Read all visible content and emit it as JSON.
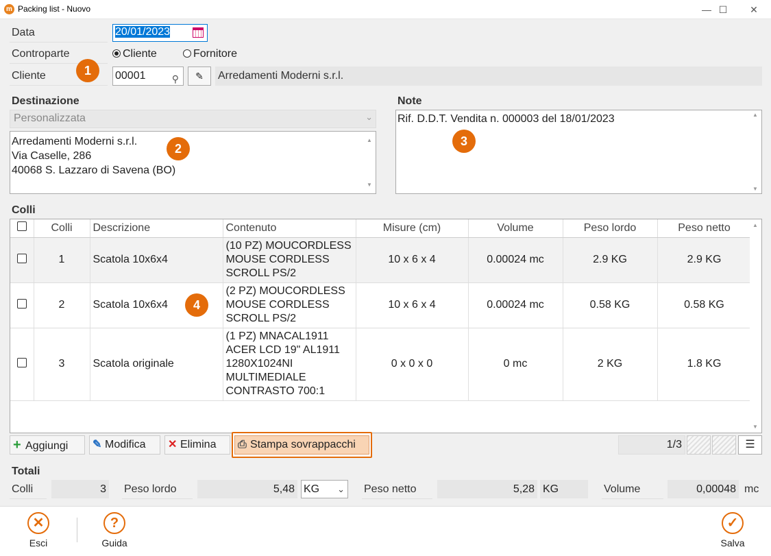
{
  "window": {
    "title": "Packing list - Nuovo",
    "minimize": "—",
    "maximize": "☐",
    "close": "✕"
  },
  "form": {
    "data_label": "Data",
    "data_value": "20/01/2023",
    "controparte_label": "Controparte",
    "radio_cliente": "Cliente",
    "radio_fornitore": "Fornitore",
    "cliente_label": "Cliente",
    "cliente_code": "00001",
    "cliente_name": "Arredamenti Moderni s.r.l."
  },
  "destinazione": {
    "title": "Destinazione",
    "select_value": "Personalizzata",
    "lines": [
      "Arredamenti Moderni s.r.l.",
      "Via Caselle, 286",
      "40068 S. Lazzaro di Savena (BO)"
    ]
  },
  "note": {
    "title": "Note",
    "text": "Rif. D.D.T. Vendita n. 000003 del 18/01/2023"
  },
  "badges": [
    "1",
    "2",
    "3",
    "4"
  ],
  "colli": {
    "title": "Colli",
    "headers": [
      "Colli",
      "Descrizione",
      "Contenuto",
      "Misure (cm)",
      "Volume",
      "Peso lordo",
      "Peso netto"
    ],
    "rows": [
      {
        "colli": "1",
        "descrizione": "Scatola 10x6x4",
        "contenuto": [
          "(10 PZ) MOUCORDLESS",
          "MOUSE CORDLESS",
          "SCROLL PS/2"
        ],
        "misure": "10 x 6 x 4",
        "volume": "0.00024 mc",
        "peso_lordo": "2.9 KG",
        "peso_netto": "2.9 KG"
      },
      {
        "colli": "2",
        "descrizione": "Scatola 10x6x4",
        "contenuto": [
          "(2 PZ) MOUCORDLESS",
          "MOUSE CORDLESS",
          "SCROLL PS/2"
        ],
        "misure": "10 x 6 x 4",
        "volume": "0.00024 mc",
        "peso_lordo": "0.58 KG",
        "peso_netto": "0.58 KG"
      },
      {
        "colli": "3",
        "descrizione": "Scatola originale",
        "contenuto": [
          "(1 PZ) MNACAL1911",
          "ACER LCD 19\" AL1911",
          "1280X1024NI",
          "MULTIMEDIALE",
          "CONTRASTO 700:1"
        ],
        "misure": "0 x 0 x 0",
        "volume": "0 mc",
        "peso_lordo": "2 KG",
        "peso_netto": "1.8 KG"
      }
    ]
  },
  "toolbar": {
    "aggiungi": "Aggiungi",
    "modifica": "Modifica",
    "elimina": "Elimina",
    "stampa": "Stampa sovrappacchi",
    "pager": "1/3",
    "menu": "☰"
  },
  "totali": {
    "title": "Totali",
    "colli_label": "Colli",
    "colli_value": "3",
    "peso_lordo_label": "Peso lordo",
    "peso_lordo_value": "5,48",
    "peso_lordo_unit": "KG",
    "peso_netto_label": "Peso netto",
    "peso_netto_value": "5,28",
    "peso_netto_unit": "KG",
    "volume_label": "Volume",
    "volume_value": "0,00048",
    "volume_unit": "mc"
  },
  "footer": {
    "esci": "Esci",
    "guida": "Guida",
    "salva": "Salva"
  },
  "colors": {
    "accent": "#e46c0a",
    "highlight_btn": "#f9d4b4"
  }
}
